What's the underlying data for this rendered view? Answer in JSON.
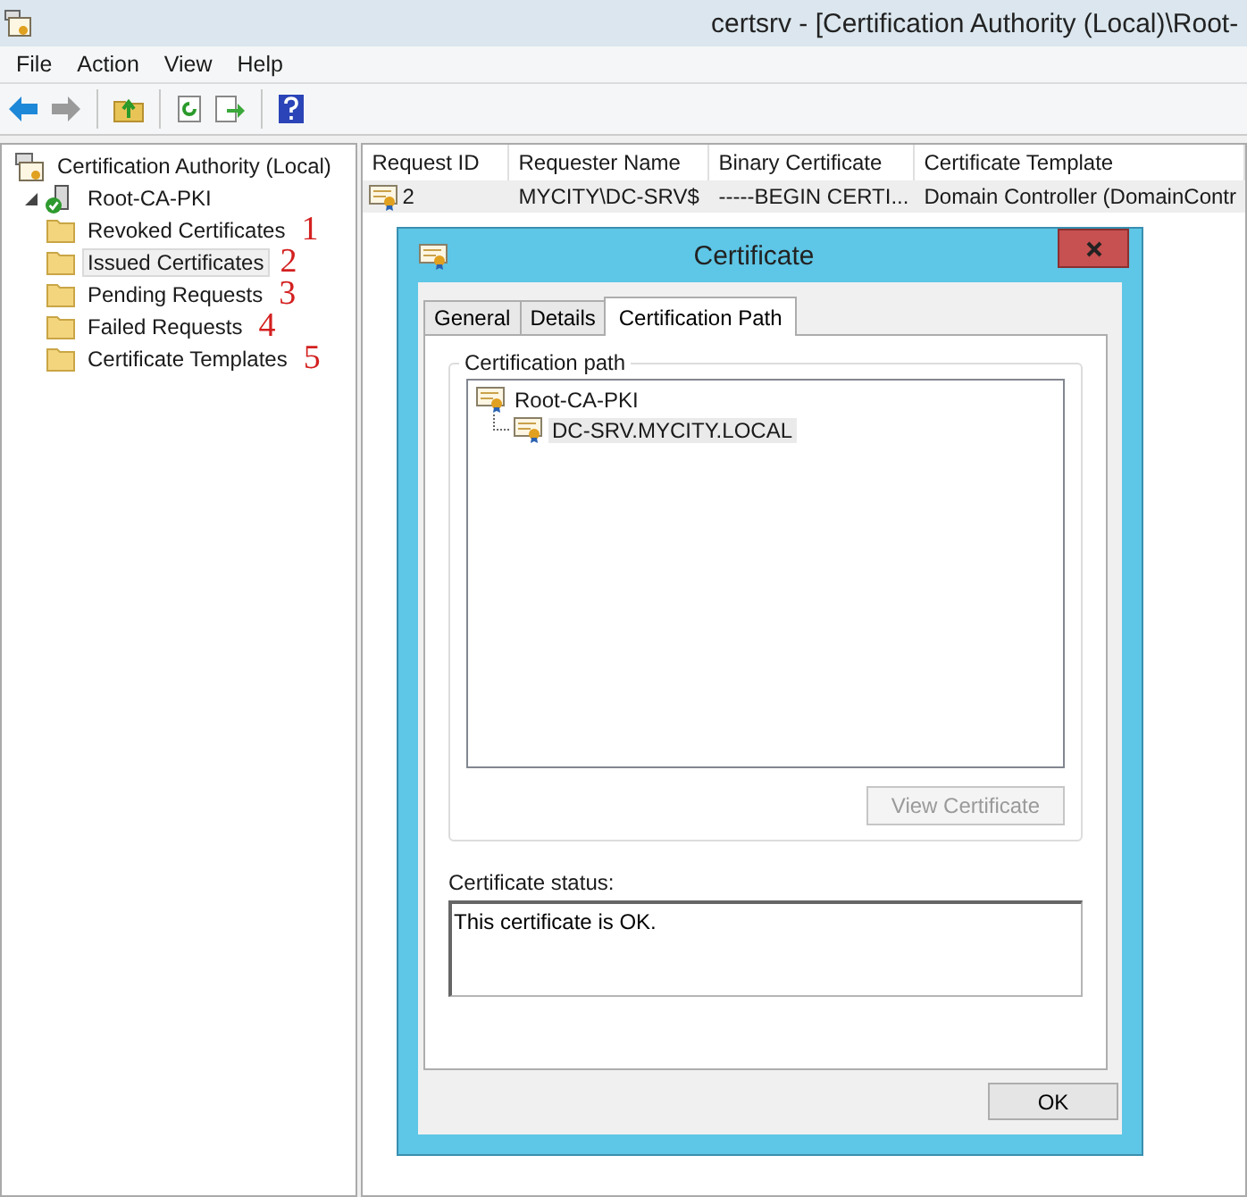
{
  "window": {
    "title": "certsrv - [Certification Authority (Local)\\Root-"
  },
  "menu": [
    "File",
    "Action",
    "View",
    "Help"
  ],
  "toolbar": [
    {
      "kind": "back",
      "disabled": false
    },
    {
      "kind": "forward",
      "disabled": true
    },
    {
      "kind": "up",
      "disabled": false
    },
    {
      "kind": "refresh",
      "disabled": false
    },
    {
      "kind": "export",
      "disabled": false
    },
    {
      "kind": "help",
      "disabled": false
    }
  ],
  "tree": [
    {
      "label": "Certification Authority (Local)",
      "kind": "console",
      "selected": false,
      "children": [
        {
          "label": "Root-CA-PKI",
          "kind": "ca",
          "selected": false,
          "expanded": true,
          "children": [
            {
              "label": "Revoked Certificates",
              "kind": "folder",
              "selected": false,
              "annotation": "1"
            },
            {
              "label": "Issued Certificates",
              "kind": "folder",
              "selected": true,
              "annotation": "2"
            },
            {
              "label": "Pending Requests",
              "kind": "folder",
              "selected": false,
              "annotation": "3"
            },
            {
              "label": "Failed Requests",
              "kind": "folder",
              "selected": false,
              "annotation": "4"
            },
            {
              "label": "Certificate Templates",
              "kind": "folder",
              "selected": false,
              "annotation": "5"
            }
          ]
        }
      ]
    }
  ],
  "table": {
    "columns": [
      "Request ID",
      "Requester Name",
      "Binary Certificate",
      "Certificate Template"
    ],
    "rows": [
      {
        "selected": true,
        "cells": [
          "2",
          "MYCITY\\DC-SRV$",
          "-----BEGIN CERTI...",
          "Domain Controller (DomainContr"
        ]
      }
    ]
  },
  "dialog": {
    "title": "Certificate",
    "tabs": [
      {
        "label": "General",
        "selected": false
      },
      {
        "label": "Details",
        "selected": false
      },
      {
        "label": "Certification Path",
        "selected": true
      }
    ],
    "group_title": "Certification path",
    "path": [
      {
        "label": "Root-CA-PKI",
        "selected": false,
        "children": [
          {
            "label": "DC-SRV.MYCITY.LOCAL",
            "selected": true
          }
        ]
      }
    ],
    "view_button": {
      "label": "View Certificate",
      "disabled": true
    },
    "status_label": "Certificate status:",
    "status_value": "This certificate is OK.",
    "ok_button": "OK"
  }
}
